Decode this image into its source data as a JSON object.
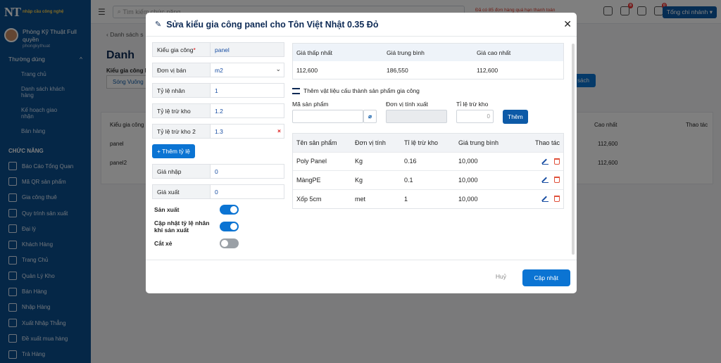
{
  "app": {
    "logo": "NT",
    "logo_tag": "nhập cầu công nghệ"
  },
  "user": {
    "name": "Phòng Kỹ Thuật Full quyền",
    "username": "phongkythuat"
  },
  "sidebar": {
    "group": "Thường dùng",
    "group_items": [
      "Trang chủ",
      "Danh sách khách hàng",
      "Kế hoạch giao nhận",
      "Bán hàng"
    ],
    "section_title": "CHỨC NĂNG",
    "items": [
      "Báo Cáo Tổng Quan",
      "Mã QR sản phẩm",
      "Gia công thuê",
      "Quy trình sản xuất",
      "Đại lý",
      "Khách Hàng",
      "Trang Chủ",
      "Quản Lý Kho",
      "Bán Hàng",
      "Nhập Hàng",
      "Xuất Nhập Thẳng",
      "Đề xuất mua hàng",
      "Trả Hàng"
    ]
  },
  "topbar": {
    "search_placeholder": "Tìm kiếm chức năng",
    "warning": "Đã có 85 đơn hàng quá hạn thanh toán",
    "badges": [
      "8",
      "0"
    ],
    "branch": "Tổng chi nhánh"
  },
  "background": {
    "breadcrumb": "Danh sách s",
    "title": "Danh",
    "filter_label": "Kiểu gia công h",
    "chip": "Sóng Vuông",
    "button": "sách",
    "table_header": {
      "col1": "Kiểu gia công",
      "col_high": "Cao nhất",
      "col_act": "Thao tác"
    },
    "rows": [
      {
        "name": "panel",
        "high": "112,600"
      },
      {
        "name": "panel2",
        "high": "112,600"
      }
    ]
  },
  "modal": {
    "title": "Sửa kiểu gia công panel cho Tôn Việt Nhật 0.35 Đỏ",
    "fields": {
      "type": {
        "label": "Kiểu gia công",
        "value": "panel"
      },
      "unit": {
        "label": "Đơn vị bán",
        "value": "m2"
      },
      "multiplier": {
        "label": "Tỷ lệ nhân",
        "value": "1"
      },
      "stock_ratio": {
        "label": "Tỷ lệ trừ kho",
        "value": "1.2"
      },
      "stock_ratio2": {
        "label": "Tỷ lệ trừ kho 2",
        "value": "1.3"
      },
      "import_price": {
        "label": "Giá nhập",
        "value": "0"
      },
      "export_price": {
        "label": "Giá xuất",
        "value": "0"
      }
    },
    "add_ratio_button": "+ Thêm tỷ lệ",
    "toggles": [
      {
        "label": "Sản xuất",
        "on": true
      },
      {
        "label": "Cập nhật tỷ lệ nhân khi sản xuất",
        "on": true
      },
      {
        "label": "Cắt xẻ",
        "on": false
      }
    ],
    "stats": {
      "headers": [
        "Giá thấp nhất",
        "Giá trung bình",
        "Giá cao nhất"
      ],
      "values": [
        "112,600",
        "186,550",
        "112,600"
      ]
    },
    "materials_title": "Thêm vật liệu cấu thành sản phẩm gia công",
    "add_form": {
      "product_label": "Mã sản phẩm",
      "unit_label": "Đơn vị tính xuất",
      "ratio_label": "Tỉ lệ trừ kho",
      "ratio_placeholder": "0",
      "button": "Thêm"
    },
    "table": {
      "headers": [
        "Tên sản phẩm",
        "Đơn vị tính",
        "Tỉ lệ trừ kho",
        "Giá trung bình",
        "Thao tác"
      ],
      "rows": [
        [
          "Poly Panel",
          "Kg",
          "0.16",
          "10,000"
        ],
        [
          "MàngPE",
          "Kg",
          "0.1",
          "10,000"
        ],
        [
          "Xốp 5cm",
          "met",
          "1",
          "10,000"
        ]
      ]
    },
    "cancel": "Huỷ",
    "submit": "Cập nhật"
  }
}
